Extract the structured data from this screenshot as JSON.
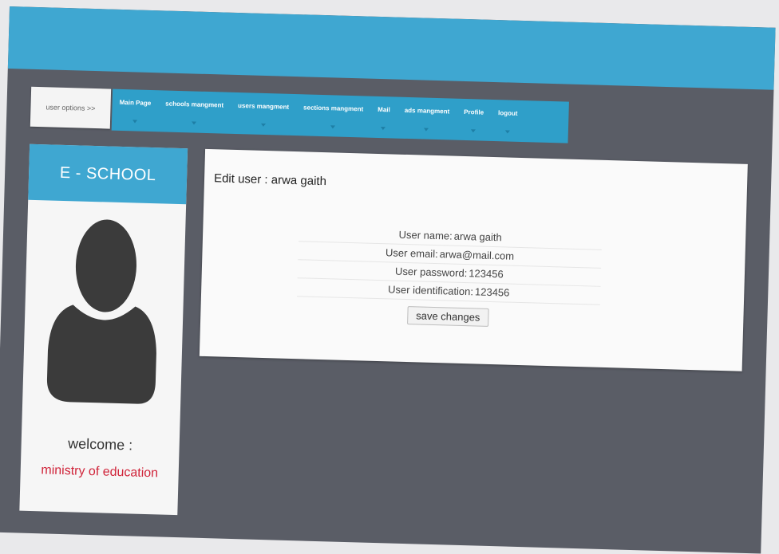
{
  "nav": {
    "user_options": "user options >>",
    "items": [
      {
        "label": "Main Page"
      },
      {
        "label": "schools mangment"
      },
      {
        "label": "users mangment"
      },
      {
        "label": "sections mangment"
      },
      {
        "label": "Mail"
      },
      {
        "label": "ads mangment"
      },
      {
        "label": "Profile"
      },
      {
        "label": "logout"
      }
    ]
  },
  "sidebar": {
    "title": "E - SCHOOL",
    "welcome": "welcome :",
    "user": "ministry of education"
  },
  "edit": {
    "title": "Edit user : arwa gaith",
    "fields": [
      {
        "label": "User name:",
        "value": "arwa gaith"
      },
      {
        "label": "User email:",
        "value": "arwa@mail.com"
      },
      {
        "label": "User password:",
        "value": "123456"
      },
      {
        "label": "User identification:",
        "value": "123456"
      }
    ],
    "save_label": "save changes"
  },
  "colors": {
    "accent": "#3fa7d1",
    "background": "#5a5d66",
    "ministry_text": "#d0243a"
  }
}
